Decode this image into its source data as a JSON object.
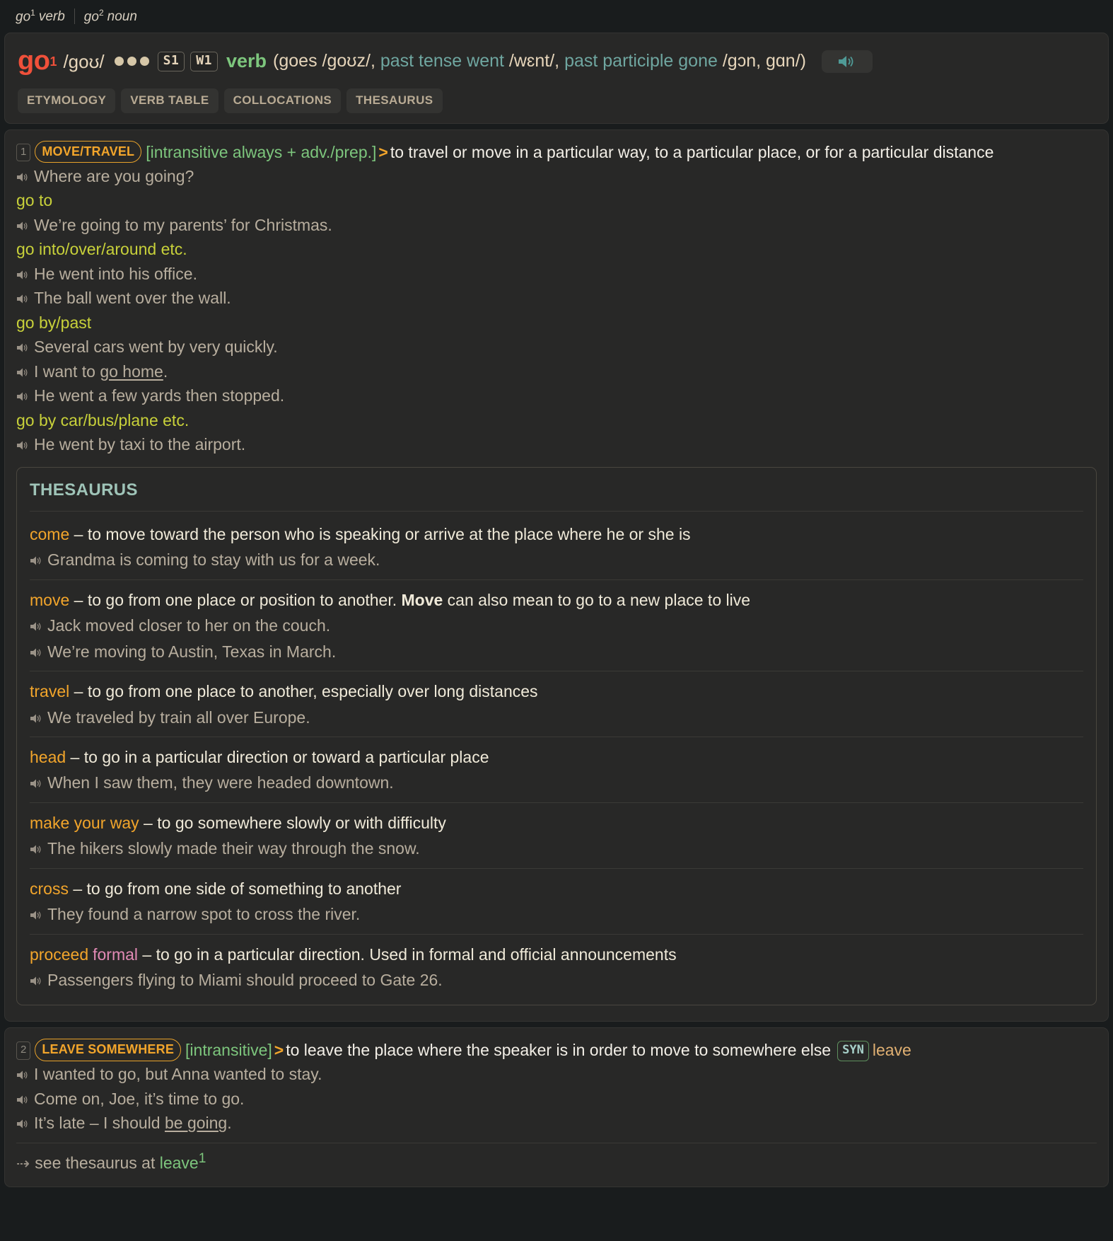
{
  "homographs": [
    {
      "word": "go",
      "sup": "1",
      "pos": "verb"
    },
    {
      "word": "go",
      "sup": "2",
      "pos": "noun"
    }
  ],
  "header": {
    "headword": "go",
    "headword_sup": "1",
    "pronunciation": "/ɡoʊ/",
    "freq_dots": 3,
    "badges": [
      "S1",
      "W1"
    ],
    "part_of_speech": "verb",
    "inflections_open": "(goes ",
    "inflections": [
      {
        "label": "",
        "ipa": "/ɡoʊz/"
      },
      {
        "label": "past tense went ",
        "ipa": "/wɛnt/"
      },
      {
        "label": "past participle gone ",
        "ipa": "/ɡɔn, ɡɑn/"
      }
    ],
    "inflections_close": ")",
    "speaker_icon": "speaker-icon",
    "tabs": [
      "ETYMOLOGY",
      "VERB TABLE",
      "COLLOCATIONS",
      "THESAURUS"
    ]
  },
  "senses": [
    {
      "number": "1",
      "topic": "MOVE/TRAVEL",
      "grammar": "[intransitive always + adv./prep.]",
      "arrow": ">",
      "definition": "to travel or move in a particular way, to a particular place, or for a particular distance",
      "blocks": [
        {
          "type": "example",
          "text": "Where are you going?"
        },
        {
          "type": "colloc",
          "text": "go to"
        },
        {
          "type": "example",
          "text": "We’re going to my parents’ for Christmas."
        },
        {
          "type": "colloc",
          "text": "go into/over/around etc."
        },
        {
          "type": "example",
          "text": "He went into his office."
        },
        {
          "type": "example",
          "text": "The ball went over the wall."
        },
        {
          "type": "colloc",
          "text": "go by/past"
        },
        {
          "type": "example",
          "text": "Several cars went by very quickly."
        },
        {
          "type": "example",
          "pre": "I want to ",
          "link": "go home",
          "post": "."
        },
        {
          "type": "example",
          "text": "He went a few yards then stopped."
        },
        {
          "type": "colloc",
          "text": "go by car/bus/plane etc."
        },
        {
          "type": "example",
          "text": "He went by taxi to the airport."
        }
      ],
      "thesaurus": {
        "title": "THESAURUS",
        "entries": [
          {
            "word": "come",
            "register": "",
            "definition": "to move toward the person who is speaking or arrive at the place where he or she is",
            "definition_bold": "",
            "definition_tail": "",
            "examples": [
              "Grandma is coming to stay with us for a week."
            ]
          },
          {
            "word": "move",
            "register": "",
            "definition": "to go from one place or position to another. ",
            "definition_bold": "Move",
            "definition_tail": " can also mean to go to a new place to live",
            "examples": [
              "Jack moved closer to her on the couch.",
              "We’re moving to Austin, Texas in March."
            ]
          },
          {
            "word": "travel",
            "register": "",
            "definition": "to go from one place to another, especially over long distances",
            "definition_bold": "",
            "definition_tail": "",
            "examples": [
              "We traveled by train all over Europe."
            ]
          },
          {
            "word": "head",
            "register": "",
            "definition": "to go in a particular direction or toward a particular place",
            "definition_bold": "",
            "definition_tail": "",
            "examples": [
              "When I saw them, they were headed downtown."
            ]
          },
          {
            "word": "make your way",
            "register": "",
            "definition": "to go somewhere slowly or with difficulty",
            "definition_bold": "",
            "definition_tail": "",
            "examples": [
              "The hikers slowly made their way through the snow."
            ]
          },
          {
            "word": "cross",
            "register": "",
            "definition": "to go from one side of something to another",
            "definition_bold": "",
            "definition_tail": "",
            "examples": [
              "They found a narrow spot to cross the river."
            ]
          },
          {
            "word": "proceed",
            "register": "formal",
            "definition": "to go in a particular direction. Used in formal and official announcements",
            "definition_bold": "",
            "definition_tail": "",
            "examples": [
              "Passengers flying to Miami should proceed to Gate 26."
            ]
          }
        ]
      }
    },
    {
      "number": "2",
      "topic": "LEAVE SOMEWHERE",
      "grammar": "[intransitive]",
      "arrow": ">",
      "definition": "to leave the place where the speaker is in order to move to somewhere else",
      "syn_badge": "SYN",
      "syn_word": "leave",
      "blocks": [
        {
          "type": "example",
          "text": "I wanted to go, but Anna wanted to stay."
        },
        {
          "type": "example",
          "text": "Come on, Joe, it’s time to go."
        },
        {
          "type": "example",
          "pre": "It’s late – I should ",
          "link": "be going",
          "post": "."
        }
      ],
      "cross_ref": {
        "dots": "⇢",
        "text": "see thesaurus at ",
        "target": "leave",
        "target_sup": "1"
      }
    }
  ]
}
